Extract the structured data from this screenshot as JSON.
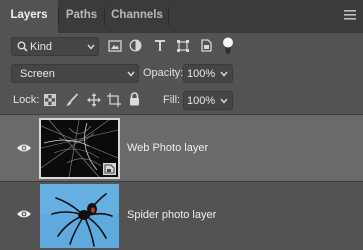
{
  "tabs": [
    {
      "label": "Layers",
      "active": true
    },
    {
      "label": "Paths",
      "active": false
    },
    {
      "label": "Channels",
      "active": false
    }
  ],
  "filter": {
    "kind_label": "Kind",
    "icons": [
      "image-filter-icon",
      "adjustment-filter-icon",
      "type-filter-icon",
      "shape-filter-icon",
      "smart-object-filter-icon",
      "filter-toggle-icon"
    ]
  },
  "blend": {
    "mode": "Screen",
    "opacity_label": "Opacity:",
    "opacity_value": "100%"
  },
  "lock": {
    "label": "Lock:",
    "icons": [
      "lock-transparent-pixels-icon",
      "lock-image-pixels-icon",
      "lock-position-icon",
      "lock-artboard-icon",
      "lock-all-icon"
    ],
    "fill_label": "Fill:",
    "fill_value": "100%"
  },
  "layers": [
    {
      "name": "Web Photo layer",
      "visible": true,
      "selected": true,
      "smart_object": true
    },
    {
      "name": "Spider photo layer",
      "visible": true,
      "selected": false,
      "smart_object": false
    }
  ],
  "colors": {
    "panel_bg": "#535353",
    "tab_bar_bg": "#3b3b3b",
    "selected_layer_bg": "#6a6a6a",
    "field_bg": "#454545",
    "sky_blue": "#5ea9dd"
  }
}
